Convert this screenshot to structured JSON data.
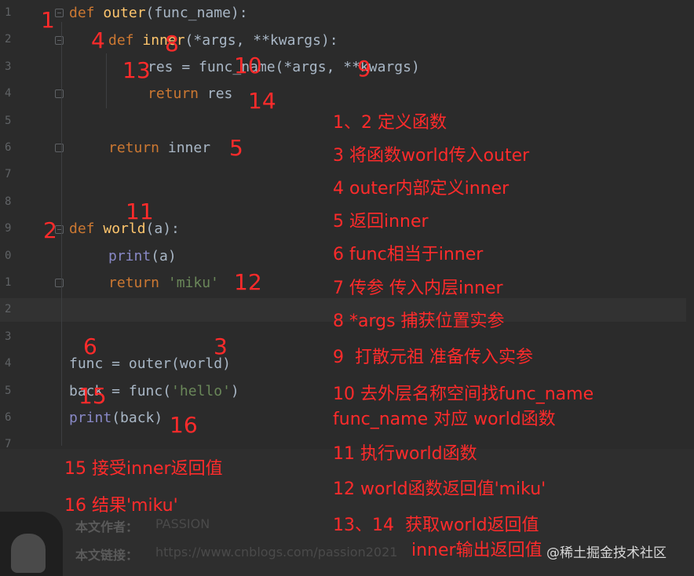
{
  "editor": {
    "line_numbers": [
      "1",
      "2",
      "3",
      "4",
      "5",
      "6",
      "7",
      "8",
      "9",
      "0",
      "1",
      "2",
      "3",
      "4",
      "5",
      "6",
      "7"
    ],
    "code": {
      "l1": {
        "kw": "def",
        "name": "outer",
        "rest": "(func_name):"
      },
      "l2": {
        "kw": "def",
        "name": "inner",
        "rest": "(*args, **kwargs):"
      },
      "l3": {
        "text": "res = func_name(*args, **kwargs)"
      },
      "l4": {
        "kw": "return",
        "rest": " res"
      },
      "l6": {
        "kw": "return",
        "rest": " inner"
      },
      "l9": {
        "kw": "def",
        "name": "world",
        "rest": "(a):"
      },
      "l10": {
        "bi": "print",
        "rest": "(a)"
      },
      "l11": {
        "kw": "return",
        "str": "'miku'"
      },
      "l14": {
        "text": "func = outer(world)"
      },
      "l15": {
        "pre": "back = func(",
        "str": "'hello'",
        "post": ")"
      },
      "l16": {
        "bi": "print",
        "rest": "(back)"
      }
    },
    "colors": {
      "background": "#2b2b2b",
      "keyword": "#cc7832",
      "function": "#ffc66d",
      "string": "#6a8759",
      "builtin": "#8888c6",
      "text": "#a9b7c6"
    }
  },
  "markers": [
    "1",
    "4",
    "8",
    "13",
    "10",
    "9",
    "14",
    "5",
    "11",
    "2",
    "12",
    "6",
    "3",
    "15",
    "16"
  ],
  "notes": {
    "n1": "1、2 定义函数",
    "n2": "3 将函数world传入outer",
    "n3": "4 outer内部定义inner",
    "n4": "5 返回inner",
    "n5": "6 func相当于inner",
    "n6": "7 传参 传入内层inner",
    "n7": "8 *args 捕获位置实参",
    "n8": "9  打散元祖 准备传入实参",
    "n9a": "10 去外层名称空间找func_name",
    "n9b": "func_name 对应 world函数",
    "n10": "11 执行world函数",
    "n11": "12 world函数返回值'miku'",
    "n12a": "13、14  获取world返回值",
    "n12b": "inner输出返回值",
    "n13": "15 接受inner返回值",
    "n14": "16 结果'miku'"
  },
  "footer": {
    "author_label": "本文作者：",
    "author_value": "PASSION",
    "link_label": "本文链接：",
    "link_value": "https://www.cnblogs.com/passion2021"
  },
  "watermark": "@稀土掘金技术社区",
  "annotation_color": "#ff2b2b"
}
